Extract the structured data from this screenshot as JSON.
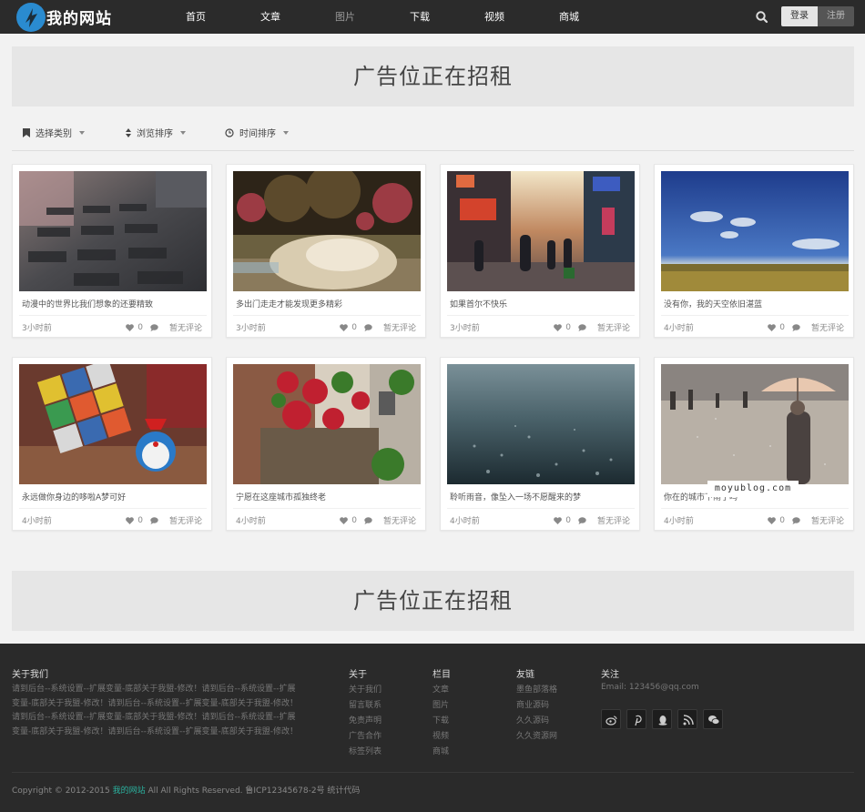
{
  "header": {
    "site_name": "我的网站",
    "nav": [
      "首页",
      "文章",
      "图片",
      "下载",
      "视频",
      "商城"
    ],
    "active_nav": 2,
    "login": "登录",
    "register": "注册"
  },
  "ads": {
    "top": "广告位正在招租",
    "bottom": "广告位正在招租"
  },
  "filters": {
    "category": "选择类别",
    "views": "浏览排序",
    "time": "时间排序"
  },
  "cards": [
    {
      "title": "动漫中的世界比我们想象的还要精致",
      "time": "3小时前",
      "likes": "0",
      "comments": "暂无评论"
    },
    {
      "title": "多出门走走才能发现更多精彩",
      "time": "3小时前",
      "likes": "0",
      "comments": "暂无评论"
    },
    {
      "title": "如果首尔不快乐",
      "time": "3小时前",
      "likes": "0",
      "comments": "暂无评论"
    },
    {
      "title": "没有你，我的天空依旧湛蓝",
      "time": "4小时前",
      "likes": "0",
      "comments": "暂无评论"
    },
    {
      "title": "永远做你身边的哆啦A梦可好",
      "time": "4小时前",
      "likes": "0",
      "comments": "暂无评论"
    },
    {
      "title": "宁愿在这座城市孤独终老",
      "time": "4小时前",
      "likes": "0",
      "comments": "暂无评论"
    },
    {
      "title": "聆听雨音，像坠入一场不愿醒来的梦",
      "time": "4小时前",
      "likes": "0",
      "comments": "暂无评论"
    },
    {
      "title": "你在的城市下雨了吗",
      "time": "4小时前",
      "likes": "0",
      "comments": "暂无评论"
    }
  ],
  "watermark": "moyublog.com",
  "footer": {
    "about_title": "关于我们",
    "about_text": "请到后台--系统设置--扩展变量-底部关于我盟-修改！请到后台--系统设置--扩展变量-底部关于我盟-修改！请到后台--系统设置--扩展变量-底部关于我盟-修改！请到后台--系统设置--扩展变量-底部关于我盟-修改！请到后台--系统设置--扩展变量-底部关于我盟-修改！请到后台--系统设置--扩展变量-底部关于我盟-修改！",
    "col_about_title": "关于",
    "col_about": [
      "关于我们",
      "留言联系",
      "免责声明",
      "广告合作",
      "标签列表"
    ],
    "col_section_title": "栏目",
    "col_section": [
      "文章",
      "图片",
      "下载",
      "视频",
      "商城"
    ],
    "col_links_title": "友链",
    "col_links": [
      "墨鱼部落格",
      "商业源码",
      "久久源码",
      "久久资源网"
    ],
    "col_follow_title": "关注",
    "email": "Email: 123456@qq.com",
    "copyright_prefix": "Copyright © 2012-2015 ",
    "copyright_brand": "我的网站",
    "copyright_suffix": " All All Rights Reserved. 鲁ICP12345678-2号 统计代码"
  }
}
